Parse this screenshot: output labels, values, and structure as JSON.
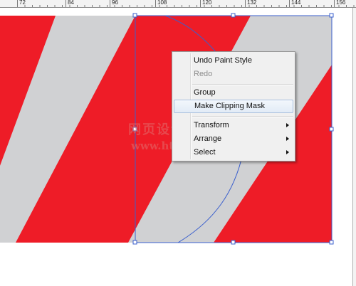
{
  "ruler": {
    "labels": [
      "72",
      "84",
      "96",
      "108",
      "120",
      "132",
      "144",
      "156"
    ]
  },
  "context_menu": {
    "items": [
      {
        "label": "Undo Paint Style",
        "enabled": true
      },
      {
        "label": "Redo",
        "enabled": false
      },
      {
        "label": "Group",
        "enabled": true
      },
      {
        "label": "Make Clipping Mask",
        "enabled": true,
        "highlighted": true
      },
      {
        "label": "Transform",
        "enabled": true,
        "submenu": true
      },
      {
        "label": "Arrange",
        "enabled": true,
        "submenu": true
      },
      {
        "label": "Select",
        "enabled": true,
        "submenu": true
      }
    ]
  },
  "watermark": {
    "line1": "网页设计学姓者",
    "line2": "www.html.cg.cn"
  },
  "colors": {
    "stripe_red": "#ee1c27",
    "stripe_gray": "#d0d1d3",
    "selection_blue": "#3a5fcd"
  }
}
